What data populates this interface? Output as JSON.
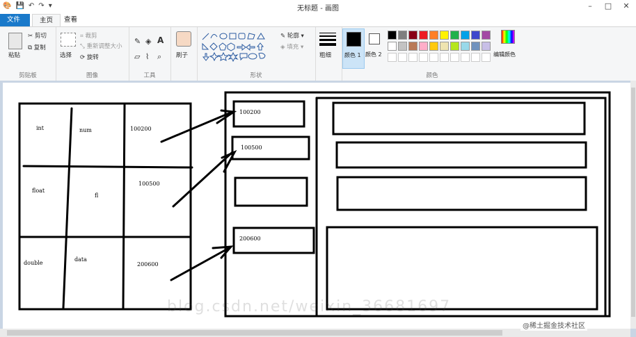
{
  "window": {
    "title": "无标题 - 画图",
    "minimize": "–",
    "maximize": "□",
    "close": "✕"
  },
  "tabs": {
    "file": "文件",
    "home": "主页",
    "view": "查看"
  },
  "ribbon": {
    "clipboard": {
      "paste": "粘贴",
      "cut": "剪切",
      "copy": "复制",
      "label": "剪贴板"
    },
    "image": {
      "select": "选择",
      "crop": "裁剪",
      "resize": "重新调整大小",
      "rotate": "旋转",
      "label": "图像"
    },
    "tools": {
      "label": "工具"
    },
    "brushes": {
      "label": "刷子"
    },
    "shapes": {
      "outline": "轮廓",
      "fill": "填充",
      "label": "形状"
    },
    "size": {
      "label": "粗细"
    },
    "colors": {
      "color1": "颜色 1",
      "color2": "颜色 2",
      "edit": "编辑颜色",
      "label": "颜色"
    }
  },
  "palette": [
    "#000000",
    "#7f7f7f",
    "#880015",
    "#ed1c24",
    "#ff7f27",
    "#fff200",
    "#22b14c",
    "#00a2e8",
    "#3f48cc",
    "#a349a4",
    "#ffffff",
    "#c3c3c3",
    "#b97a57",
    "#ffaec9",
    "#ffc90e",
    "#efe4b0",
    "#b5e61d",
    "#99d9ea",
    "#7092be",
    "#c8bfe7"
  ],
  "drawing": {
    "table_cells": [
      [
        "int",
        "num",
        "100200"
      ],
      [
        "float",
        "fl",
        "100500"
      ],
      [
        "double",
        "data",
        "200600"
      ]
    ],
    "memory_labels": [
      "100200",
      "100500",
      "",
      "200600"
    ]
  },
  "watermark": {
    "blog": "blog.csdn.net/weixin_36681697",
    "site": "@稀土掘金技术社区"
  }
}
